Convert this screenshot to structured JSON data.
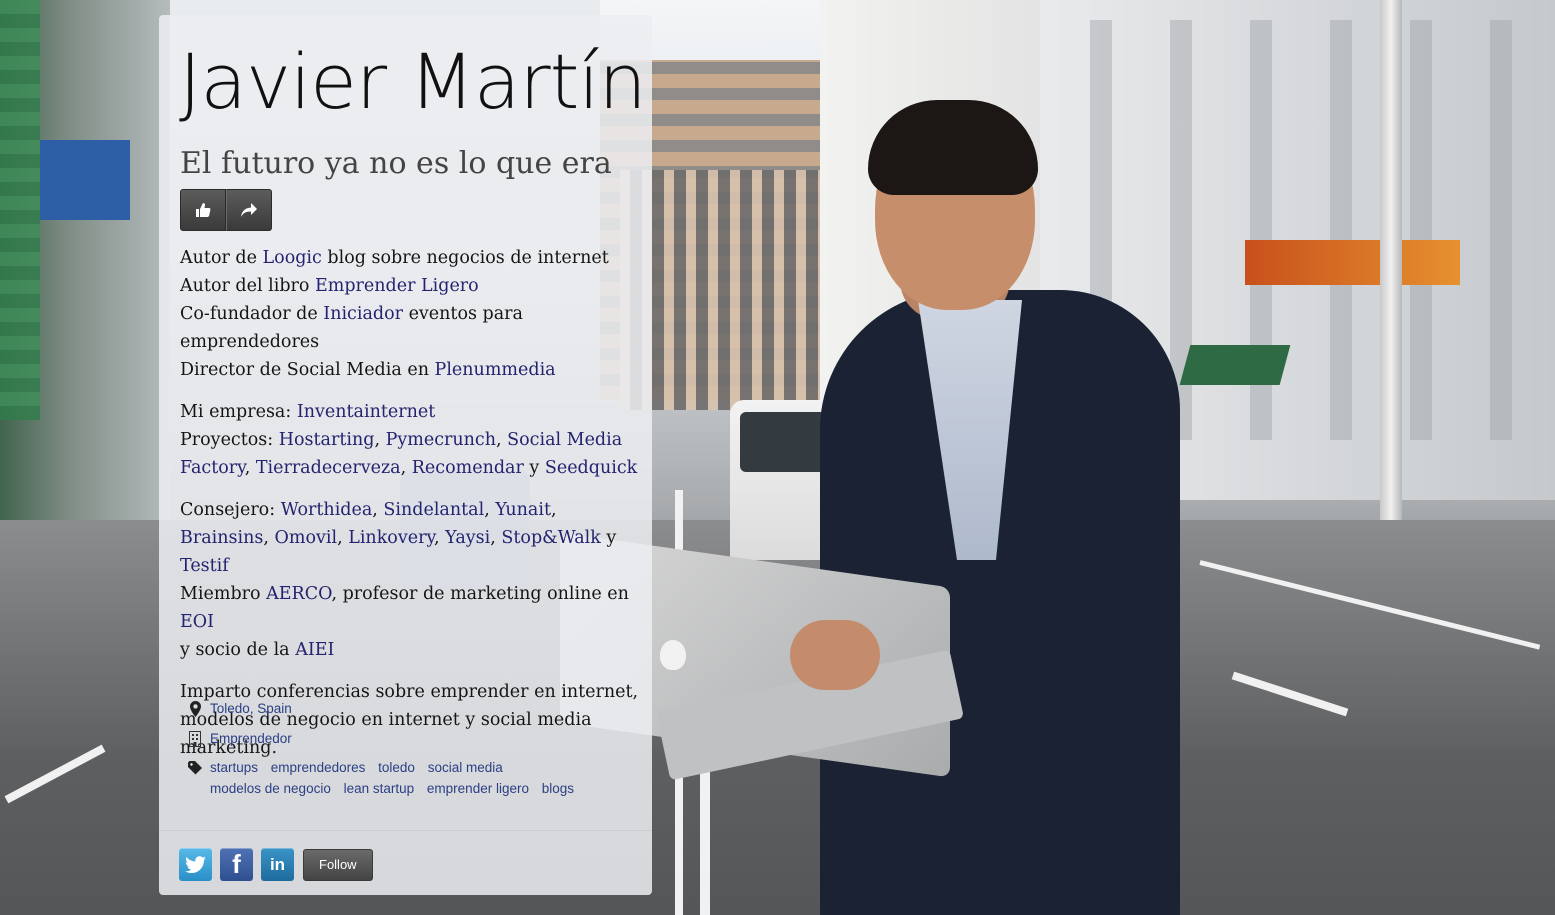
{
  "profile": {
    "name": "Javier Martín",
    "tagline": "El futuro ya no es lo que era"
  },
  "actions": {
    "like_icon": "thumbs-up-icon",
    "share_icon": "share-arrow-icon"
  },
  "bio": {
    "p1": {
      "l1_pre": "Autor de ",
      "l1_link": "Loogic",
      "l1_post": " blog sobre negocios de internet",
      "l2_pre": "Autor del libro ",
      "l2_link": "Emprender Ligero",
      "l3_pre": "Co-fundador de ",
      "l3_link": "Iniciador",
      "l3_post": " eventos para emprendedores",
      "l4_pre": "Director de Social Media en ",
      "l4_link": "Plenummedia"
    },
    "p2": {
      "l1_pre": "Mi empresa: ",
      "l1_link": "Inventainternet",
      "l2_pre": "Proyectos: ",
      "links": [
        "Hostarting",
        "Pymecrunch",
        "Social Media Factory",
        "Tierradecerveza",
        "Recomendar",
        "Seedquick"
      ],
      "and": " y "
    },
    "p3": {
      "pre": "Consejero: ",
      "links": [
        "Worthidea",
        "Sindelantal",
        "Yunait",
        "Brainsins",
        "Omovil",
        "Linkovery",
        "Yaysi",
        "Stop&Walk",
        "Testif"
      ],
      "and": " y ",
      "member_pre": "Miembro ",
      "member_link": "AERCO",
      "member_mid": ", profesor de marketing online en ",
      "eoi_link": "EOI",
      "socio_pre": "y socio de la ",
      "aiei_link": "AIEI"
    },
    "p4": "Imparto conferencias sobre emprender en internet, modelos de negocio en internet y social media marketing."
  },
  "meta": {
    "location": "Toledo, Spain",
    "occupation": "Emprendedor",
    "tags": [
      "startups",
      "emprendedores",
      "toledo",
      "social media",
      "modelos de negocio",
      "lean startup",
      "emprender ligero",
      "blogs"
    ]
  },
  "social": {
    "twitter_icon": "twitter-icon",
    "facebook_label": "f",
    "linkedin_label": "in",
    "follow_label": "Follow"
  },
  "colors": {
    "link": "#23236f",
    "meta_link": "#2b3f84",
    "panel": "rgba(236,238,241,0.86)"
  }
}
